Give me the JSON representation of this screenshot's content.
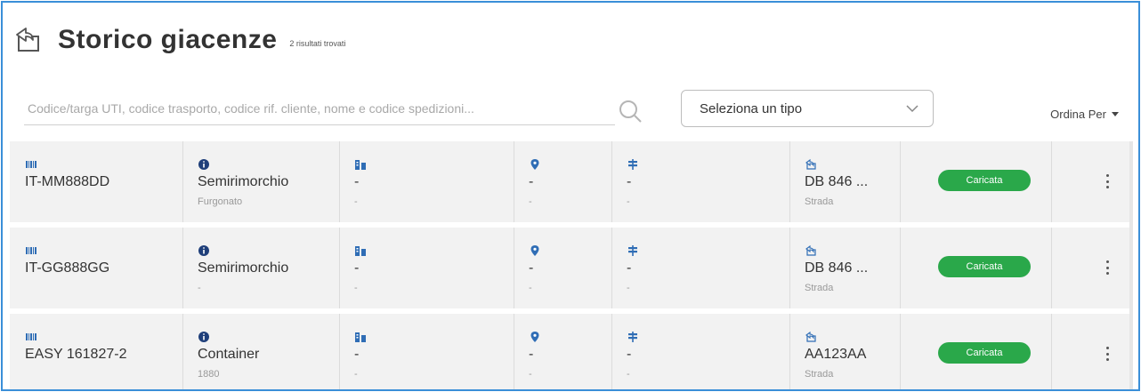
{
  "header": {
    "title": "Storico giacenze",
    "result_count": "2 risultati trovati"
  },
  "search": {
    "placeholder": "Codice/targa UTI, codice trasporto, codice rif. cliente, nome e codice spedizioni..."
  },
  "filter": {
    "selected": "Seleziona un tipo"
  },
  "sort": {
    "label": "Ordina Per"
  },
  "colors": {
    "accent": "#2f6db5",
    "badge_green": "#2aa84a",
    "row_bg": "#f2f2f2",
    "frame_border": "#3a8fd8"
  },
  "rows": [
    {
      "uti": "IT-MM888DD",
      "type": "Semirimorchio",
      "subtype": "Furgonato",
      "building": "-",
      "building_sub": "-",
      "location": "-",
      "location_sub": "-",
      "signal": "-",
      "signal_sub": "-",
      "transport": "DB 846 ...",
      "transport_mode": "Strada",
      "status": "Caricata"
    },
    {
      "uti": "IT-GG888GG",
      "type": "Semirimorchio",
      "subtype": "-",
      "building": "-",
      "building_sub": "-",
      "location": "-",
      "location_sub": "-",
      "signal": "-",
      "signal_sub": "-",
      "transport": "DB 846 ...",
      "transport_mode": "Strada",
      "status": "Caricata"
    },
    {
      "uti": "EASY 161827-2",
      "type": "Container",
      "subtype": "1880",
      "building": "-",
      "building_sub": "-",
      "location": "-",
      "location_sub": "-",
      "signal": "-",
      "signal_sub": "-",
      "transport": "AA123AA",
      "transport_mode": "Strada",
      "status": "Caricata"
    }
  ]
}
